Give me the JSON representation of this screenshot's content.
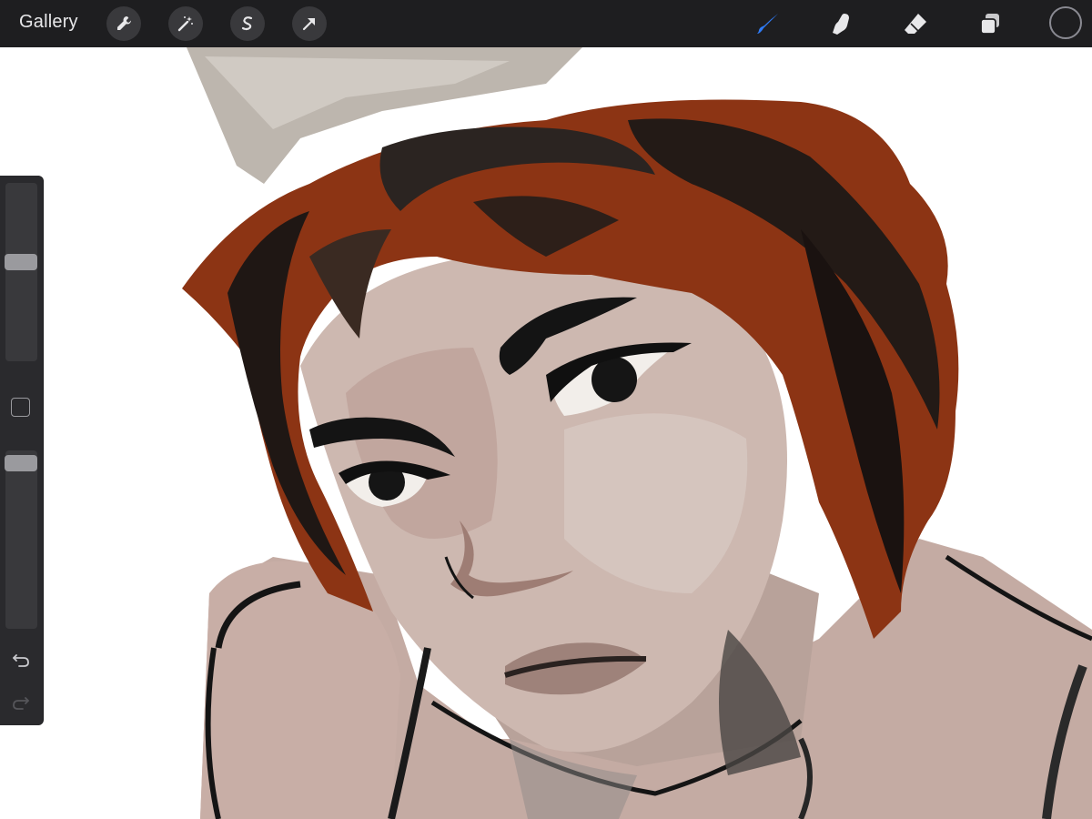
{
  "toolbar": {
    "gallery_label": "Gallery",
    "left_tools": [
      {
        "name": "actions",
        "icon": "wrench-icon"
      },
      {
        "name": "adjustments",
        "icon": "magic-wand-icon"
      },
      {
        "name": "selection",
        "icon": "selection-s-icon"
      },
      {
        "name": "transform",
        "icon": "arrow-cursor-icon"
      }
    ],
    "right_tools": [
      {
        "name": "brush",
        "icon": "brush-icon",
        "active": true
      },
      {
        "name": "smudge",
        "icon": "smudge-finger-icon",
        "active": false
      },
      {
        "name": "eraser",
        "icon": "eraser-icon",
        "active": false
      },
      {
        "name": "layers",
        "icon": "layers-icon",
        "active": false
      }
    ],
    "current_color": "#1e1e20",
    "active_color": "#2f7bf6",
    "icon_color": "#e8e8ea"
  },
  "sidebar": {
    "brush_size": 0.56,
    "brush_opacity": 0.97,
    "undo_icon": "undo-arrow-icon",
    "redo_icon": "redo-arrow-icon",
    "modifier_icon": "square-modifier-icon"
  },
  "canvas": {
    "content": "digital-painting",
    "colors": {
      "skin": "#c8b0a8",
      "skin_shadow": "#a89088",
      "skin_light": "#d8c8c0",
      "hair_dark": "#2a1a14",
      "hair_red": "#8a3010",
      "hat": "#b8b0a8",
      "line": "#141414",
      "background": "#ffffff"
    }
  }
}
